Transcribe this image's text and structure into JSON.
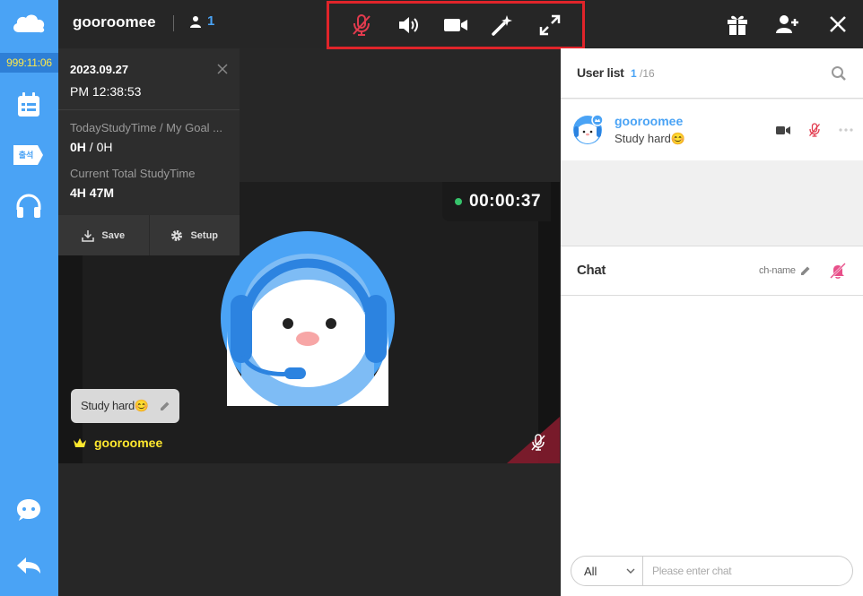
{
  "sidebar": {
    "timer": "999:11:06",
    "attendance_tag": "출석",
    "colors": {
      "bg": "#4aa3f5",
      "timer_bg": "#2e7fd6",
      "timer_text": "#ffe94a"
    }
  },
  "topbar": {
    "room_title": "gooroomee",
    "user_count": "1"
  },
  "info_panel": {
    "date": "2023.09.27",
    "time": "PM 12:38:53",
    "today_label": "TodayStudyTime / My Goal ...",
    "today_value_a": "0H",
    "today_value_sep": " / ",
    "today_value_b": "0H",
    "total_label": "Current Total StudyTime",
    "total_value": "4H 47M",
    "save_label": "Save",
    "setup_label": "Setup"
  },
  "video": {
    "stopwatch": "00:00:37",
    "status_message": "Study hard😊",
    "user_name": "gooroomee"
  },
  "user_list": {
    "title": "User list",
    "count_current": "1",
    "count_total": "/16",
    "users": [
      {
        "name": "gooroomee",
        "status": "Study hard😊"
      }
    ]
  },
  "chat": {
    "title": "Chat",
    "channel_name": "ch-name",
    "target_selected": "All",
    "input_placeholder": "Please enter chat"
  }
}
